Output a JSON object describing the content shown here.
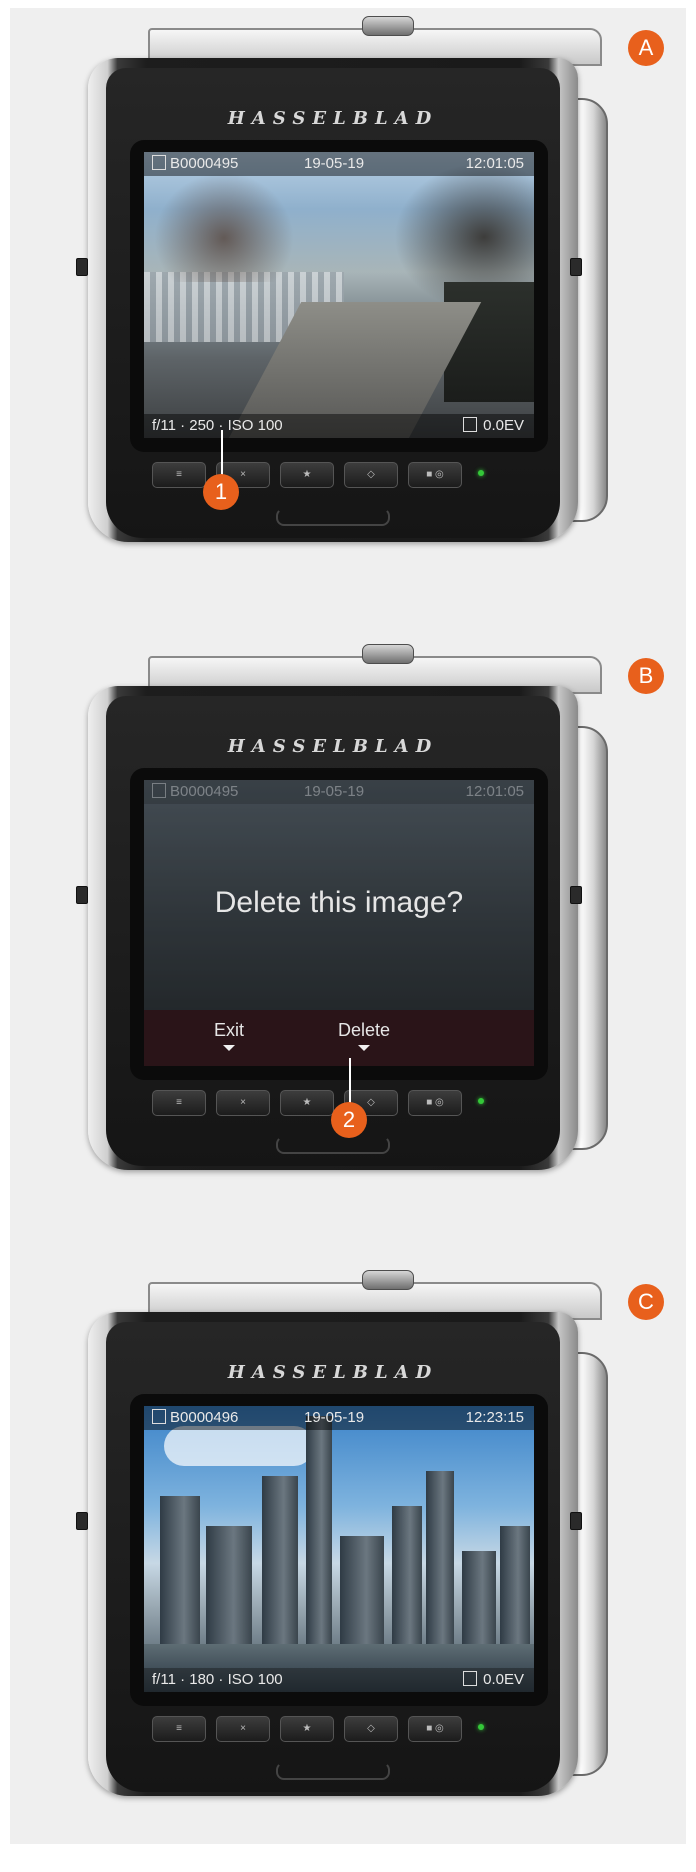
{
  "camera": {
    "brand": "HASSELBLAD"
  },
  "buttons": [
    "≡",
    "×",
    "★",
    "◇",
    "■ ◎"
  ],
  "steps": [
    {
      "letter": "A",
      "screen": {
        "file": "B0000495",
        "date": "19-05-19",
        "time": "12:01:05",
        "exposure": "f/11 · 250 · ISO 100",
        "ev": "0.0EV"
      },
      "callout": "1"
    },
    {
      "letter": "B",
      "screen": {
        "file": "B0000495",
        "date": "19-05-19",
        "time": "12:01:05",
        "dialog": "Delete this image?",
        "softkeys": {
          "left": "Exit",
          "right": "Delete"
        }
      },
      "callout": "2"
    },
    {
      "letter": "C",
      "screen": {
        "file": "B0000496",
        "date": "19-05-19",
        "time": "12:23:15",
        "exposure": "f/11 · 180 · ISO 100",
        "ev": "0.0EV"
      }
    }
  ]
}
